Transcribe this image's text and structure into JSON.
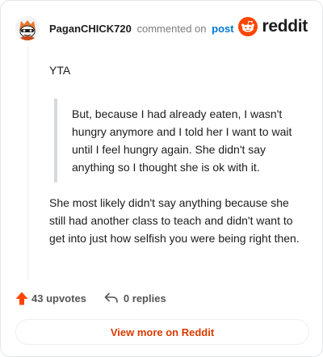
{
  "header": {
    "username": "PaganCHICK720",
    "action_text": "commented on",
    "post_link": "post",
    "brand": "reddit",
    "avatar_icon": "snoo-avatar-icon",
    "brand_color": "#ff4500"
  },
  "comment": {
    "paragraph1": "YTA",
    "quote": "But, because I had already eaten, I wasn't hungry anymore and I told her I want to wait until I feel hungry again. She didn't say anything so I thought she is ok with it.",
    "paragraph2": "She most likely didn't say anything because she still had another class to teach and didn't want to get into just how selfish you were being right then."
  },
  "actions": {
    "upvotes": "43 upvotes",
    "replies": "0 replies",
    "upvote_icon": "upvote-arrow-icon",
    "reply_icon": "reply-icon",
    "upvote_color": "#ff4500"
  },
  "footer": {
    "view_more": "View more on Reddit",
    "link_color": "#d93a00"
  }
}
